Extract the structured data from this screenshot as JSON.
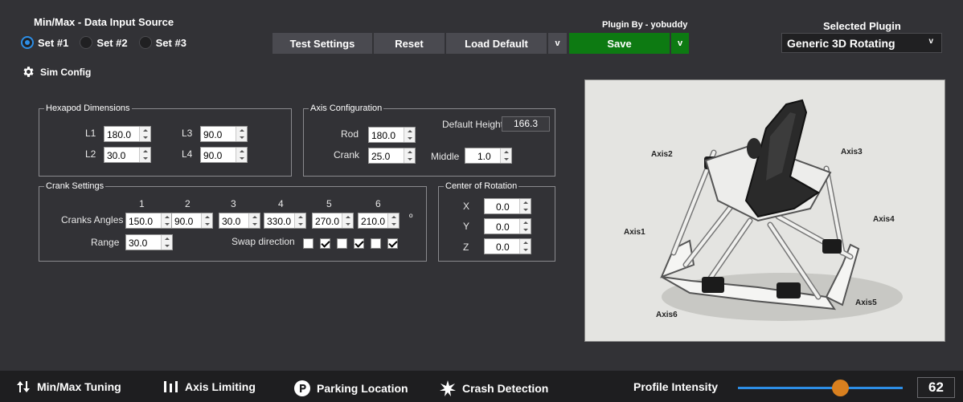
{
  "header": {
    "data_source_title": "Min/Max - Data Input Source",
    "sets": [
      {
        "label": "Set #1",
        "selected": true
      },
      {
        "label": "Set #2",
        "selected": false
      },
      {
        "label": "Set #3",
        "selected": false
      }
    ],
    "sim_config_label": "Sim Config",
    "plugin_by": "Plugin By - yobuddy",
    "selected_plugin_label": "Selected Plugin",
    "selected_plugin_value": "Generic 3D Rotating",
    "dropdown_chevron": "v"
  },
  "toolbar": {
    "test_settings": "Test Settings",
    "reset": "Reset",
    "load_default": "Load Default",
    "load_default_more": "v",
    "save": "Save",
    "save_more": "v"
  },
  "hexapod": {
    "title": "Hexapod Dimensions",
    "L1_label": "L1",
    "L1": "180.0",
    "L2_label": "L2",
    "L2": "30.0",
    "L3_label": "L3",
    "L3": "90.0",
    "L4_label": "L4",
    "L4": "90.0"
  },
  "axis_config": {
    "title": "Axis Configuration",
    "rod_label": "Rod",
    "rod": "180.0",
    "crank_label": "Crank",
    "crank": "25.0",
    "default_height_label": "Default Height",
    "default_height": "166.3",
    "middle_label": "Middle",
    "middle": "1.0"
  },
  "crank_settings": {
    "title": "Crank Settings",
    "columns": [
      "1",
      "2",
      "3",
      "4",
      "5",
      "6"
    ],
    "angles_label": "Cranks Angles",
    "angles": [
      "150.0",
      "90.0",
      "30.0",
      "330.0",
      "270.0",
      "210.0"
    ],
    "degree_symbol": "º",
    "range_label": "Range",
    "range": "30.0",
    "swap_label": "Swap direction",
    "swap": [
      false,
      true,
      false,
      true,
      false,
      true
    ]
  },
  "center_of_rotation": {
    "title": "Center of Rotation",
    "x_label": "X",
    "x": "0.0",
    "y_label": "Y",
    "y": "0.0",
    "z_label": "Z",
    "z": "0.0"
  },
  "diagram": {
    "axis_labels": [
      "Axis1",
      "Axis2",
      "Axis3",
      "Axis4",
      "Axis5",
      "Axis6"
    ]
  },
  "bottom_bar": {
    "min_max_tuning": "Min/Max Tuning",
    "axis_limiting": "Axis Limiting",
    "parking_location": "Parking Location",
    "crash_detection": "Crash Detection",
    "profile_intensity_label": "Profile Intensity",
    "profile_intensity": "62",
    "profile_intensity_fraction": 0.62
  },
  "colors": {
    "background": "#323236",
    "accent_blue": "#2d8ee6",
    "save_green": "#0d7a12",
    "slider_thumb": "#d9801f"
  }
}
